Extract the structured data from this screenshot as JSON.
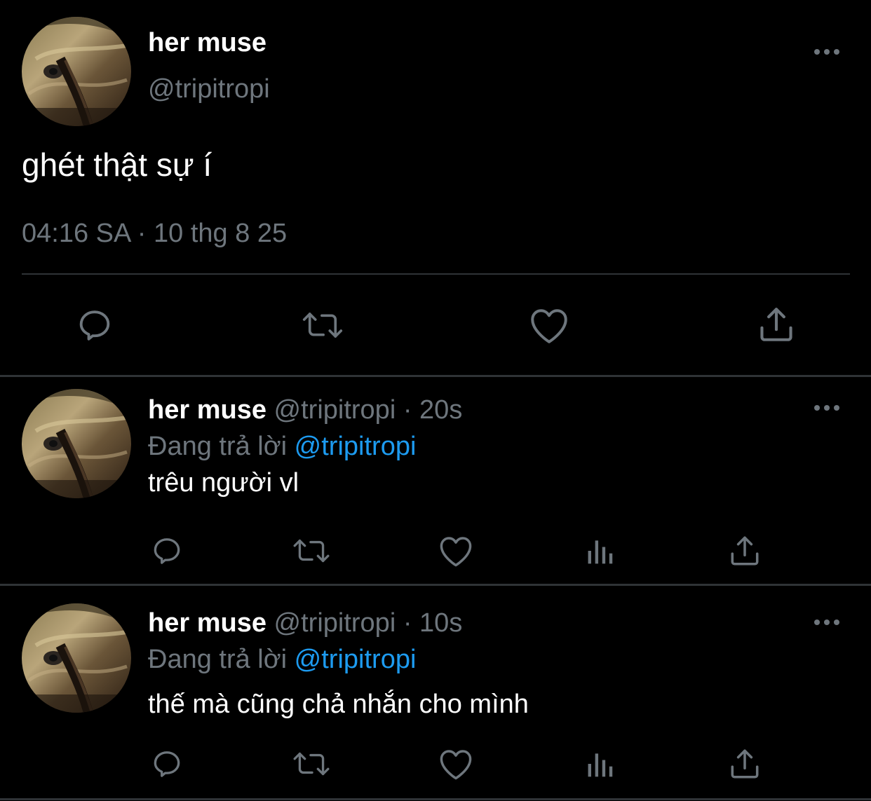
{
  "colors": {
    "background": "#000000",
    "text_primary": "#ffffff",
    "text_secondary": "#6e767d",
    "link": "#1d9bf0",
    "divider": "#2f3336"
  },
  "main_tweet": {
    "display_name": "her muse",
    "handle": "@tripitropi",
    "text": "ghét thật sự í",
    "timestamp": "04:16 SA · 10 thg 8 25",
    "actions": [
      "reply-icon",
      "retweet-icon",
      "like-icon",
      "share-icon"
    ]
  },
  "replies": [
    {
      "display_name": "her muse",
      "handle": "@tripitropi",
      "dot": "·",
      "time": "20s",
      "replying_label": "Đang trả lời",
      "replying_to": "@tripitropi",
      "text": "trêu người vl",
      "actions": [
        "reply-icon",
        "retweet-icon",
        "like-icon",
        "analytics-icon",
        "share-icon"
      ]
    },
    {
      "display_name": "her muse",
      "handle": "@tripitropi",
      "dot": "·",
      "time": "10s",
      "replying_label": "Đang trả lời",
      "replying_to": "@tripitropi",
      "text": "thế mà cũng chả nhắn cho mình",
      "actions": [
        "reply-icon",
        "retweet-icon",
        "like-icon",
        "analytics-icon",
        "share-icon"
      ]
    }
  ]
}
